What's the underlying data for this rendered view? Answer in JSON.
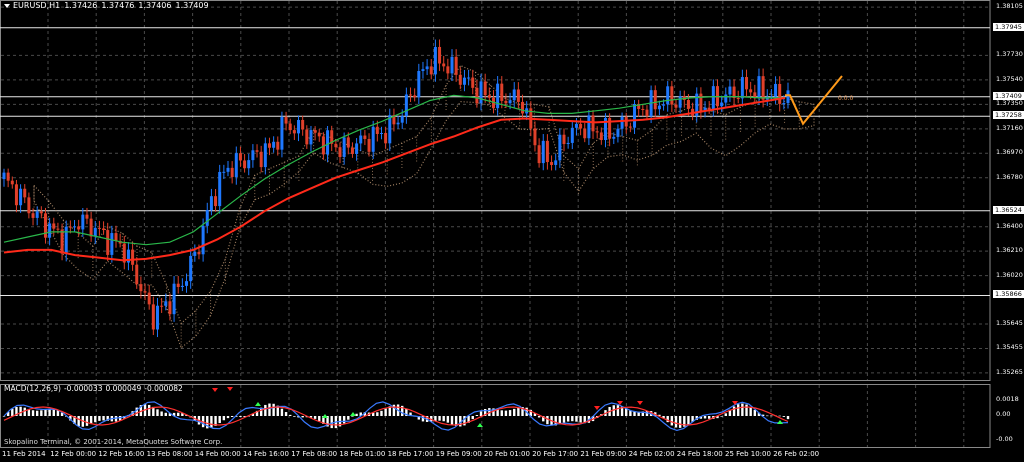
{
  "chart_header": {
    "symbol": "EURUSD,H1",
    "open": "1.37426",
    "high": "1.37476",
    "low": "1.37406",
    "close": "1.37409"
  },
  "macd_header": {
    "name": "MACD(12,26,9)",
    "main": "-0.000033",
    "signal": "0.000049",
    "histogram": "-0.000082"
  },
  "copyright": "Skopalino Terminal, © 2001-2014, MetaQuotes Software Corp.",
  "fibo_label": "0.0.0",
  "colors": {
    "background": "#000000",
    "grid": "#4a4a4a",
    "bull_candle": "#1e78ff",
    "bear_candle": "#e0402a",
    "ma_red": "#ff2a1a",
    "ma_green": "#2ab84a",
    "ichimoku_cloud": "#c9a07a",
    "zigzag": "#ff9a1a",
    "macd_main": "#3a7aff",
    "macd_signal": "#ff3030",
    "histogram": "#ffffff",
    "arrow_up": "#30ff50",
    "arrow_down": "#ff2020"
  },
  "chart_data": {
    "type": "candlestick",
    "symbol": "EURUSD",
    "timeframe": "H1",
    "price_axis_ticks": [
      "1.38105",
      "1.37730",
      "1.37540",
      "1.37350",
      "1.37160",
      "1.36970",
      "1.36780",
      "1.36400",
      "1.36210",
      "1.36020",
      "1.35645",
      "1.35455",
      "1.35265"
    ],
    "price_axis_min": 1.3521,
    "price_axis_max": 1.3816,
    "highlighted_levels": [
      "1.37945",
      "1.37409",
      "1.37258",
      "1.36524",
      "1.35866"
    ],
    "time_axis_ticks": [
      "11 Feb 2014",
      "12 Feb 00:00",
      "12 Feb 16:00",
      "13 Feb 08:00",
      "14 Feb 00:00",
      "14 Feb 16:00",
      "17 Feb 08:00",
      "18 Feb 01:00",
      "18 Feb 17:00",
      "19 Feb 09:00",
      "20 Feb 01:00",
      "20 Feb 17:00",
      "21 Feb 09:00",
      "24 Feb 02:00",
      "24 Feb 18:00",
      "25 Feb 10:00",
      "26 Feb 02:00"
    ],
    "close_path": [
      1.3677,
      1.3665,
      1.365,
      1.364,
      1.363,
      1.3645,
      1.364,
      1.363,
      1.3625,
      1.36,
      1.357,
      1.358,
      1.3595,
      1.362,
      1.366,
      1.3685,
      1.369,
      1.3695,
      1.37,
      1.372,
      1.3715,
      1.371,
      1.3705,
      1.37,
      1.3705,
      1.371,
      1.3715,
      1.373,
      1.3755,
      1.377,
      1.3765,
      1.3755,
      1.3745,
      1.374,
      1.374,
      1.3738,
      1.37,
      1.369,
      1.371,
      1.3718,
      1.3715,
      1.3712,
      1.372,
      1.3732,
      1.3735,
      1.374,
      1.3735,
      1.3732,
      1.3738,
      1.3742,
      1.3748,
      1.3745,
      1.3742,
      1.374
    ],
    "ma_red_path": [
      1.362,
      1.3622,
      1.3622,
      1.3618,
      1.3616,
      1.3614,
      1.3615,
      1.3618,
      1.3622,
      1.363,
      1.364,
      1.3652,
      1.3662,
      1.367,
      1.3678,
      1.3684,
      1.369,
      1.3697,
      1.3704,
      1.371,
      1.3717,
      1.3723,
      1.3724,
      1.3723,
      1.3722,
      1.3721,
      1.3722,
      1.3723,
      1.3725,
      1.3728,
      1.3731,
      1.3734,
      1.3737,
      1.374
    ],
    "ma_green_path": [
      1.3628,
      1.3632,
      1.3636,
      1.3636,
      1.3632,
      1.3628,
      1.3626,
      1.3628,
      1.3636,
      1.365,
      1.3664,
      1.3677,
      1.3688,
      1.3698,
      1.3707,
      1.3715,
      1.3722,
      1.373,
      1.3738,
      1.3742,
      1.374,
      1.3735,
      1.373,
      1.3728,
      1.3728,
      1.373,
      1.3732,
      1.3735,
      1.3738,
      1.374,
      1.3741,
      1.3741,
      1.374,
      1.374
    ],
    "zigzag_forecast": [
      1.3742,
      1.3742,
      1.372,
      1.3757
    ],
    "macd": {
      "main": -3.3e-05,
      "signal": 4.9e-05,
      "histogram": -8.2e-05,
      "axis_ticks": [
        "0.0018",
        "0.00",
        "-0.00"
      ]
    }
  }
}
